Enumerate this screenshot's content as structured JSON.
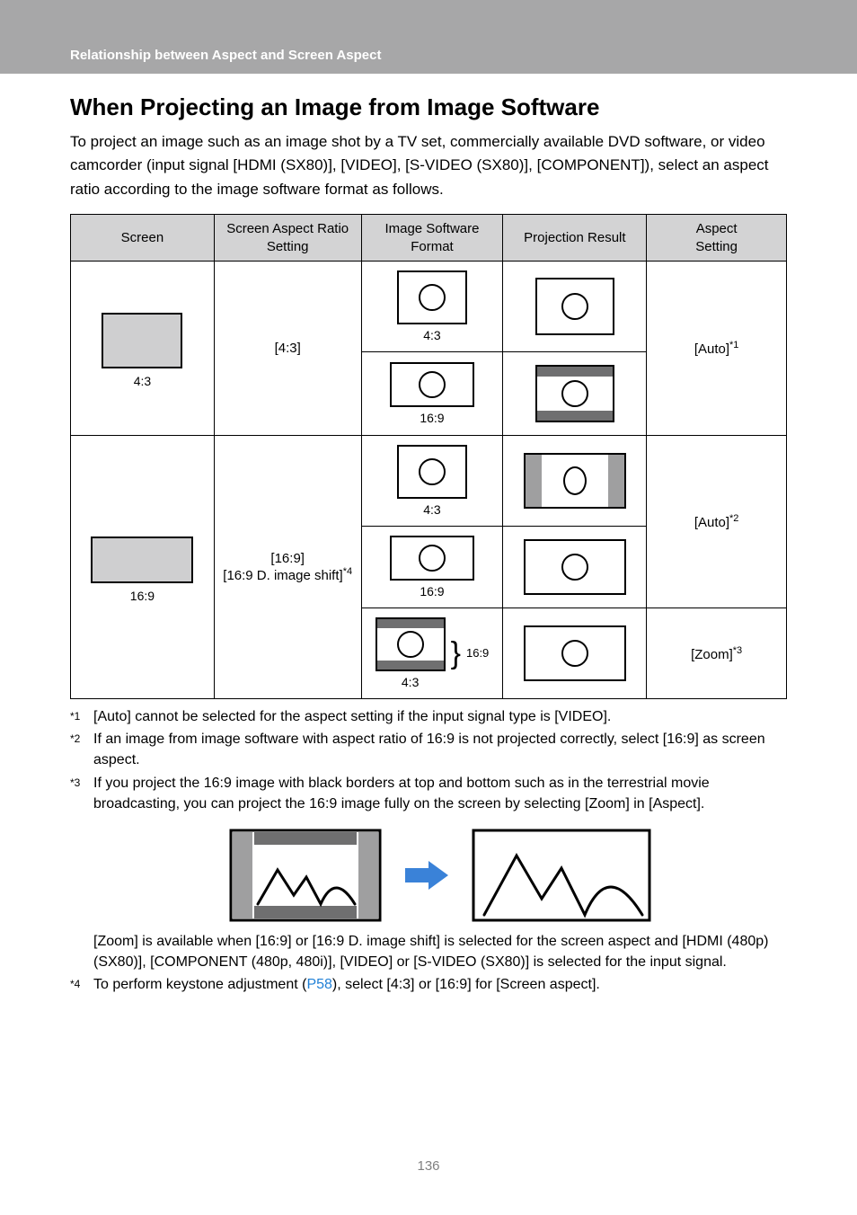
{
  "header": {
    "band_title": "Relationship between Aspect and Screen Aspect"
  },
  "section": {
    "title": "When Projecting an Image from Image Software",
    "intro": "To project an image such as an image shot by a TV set, commercially available DVD software, or video camcorder (input signal [HDMI (SX80)], [VIDEO], [S-VIDEO (SX80)], [COMPONENT]), select an aspect ratio according to the image software format as follows."
  },
  "table": {
    "headers": {
      "screen": "Screen",
      "screen_aspect": "Screen Aspect Ratio\nSetting",
      "format": "Image Software\nFormat",
      "result": "Projection Result",
      "aspect": "Aspect\nSetting"
    },
    "rows": {
      "r1": {
        "screen_label": "4:3",
        "screen_setting": "[4:3]",
        "fmt1": "4:3",
        "fmt2": "16:9",
        "aspect": "[Auto]",
        "aspect_sup": "*1"
      },
      "r2": {
        "screen_label": "16:9",
        "screen_setting_line1": "[16:9]",
        "screen_setting_line2": "[16:9 D. image shift]",
        "screen_setting_sup": "*4",
        "fmt1": "4:3",
        "fmt2": "16:9",
        "fmt3a": "16:9",
        "fmt3b": "4:3",
        "aspect1": "[Auto]",
        "aspect1_sup": "*2",
        "aspect2": "[Zoom]",
        "aspect2_sup": "*3"
      }
    }
  },
  "footnotes": {
    "f1": {
      "mark": "*1",
      "text": "[Auto] cannot be selected for the aspect setting if the input signal type is [VIDEO]."
    },
    "f2": {
      "mark": "*2",
      "text": "If an image from image software with aspect ratio of 16:9 is not projected correctly, select [16:9] as screen aspect."
    },
    "f3": {
      "mark": "*3",
      "text": "If you project the 16:9 image with black borders at top and bottom such as in the terrestrial movie broadcasting, you can project the 16:9 image fully on the screen by selecting [Zoom] in [Aspect]."
    },
    "f3b": {
      "text_a": "[Zoom] is available when [16:9] or [16:9 D. image shift] is selected for the screen aspect and [HDMI (480p)(SX80)], [COMPONENT (480p, 480i)], [VIDEO] or [S-VIDEO (SX80)] is selected for the input signal."
    },
    "f4": {
      "mark": "*4",
      "text_a": "To perform keystone adjustment (",
      "link": "P58",
      "text_b": "), select [4:3] or [16:9] for [Screen aspect]."
    }
  },
  "page_number": "136"
}
